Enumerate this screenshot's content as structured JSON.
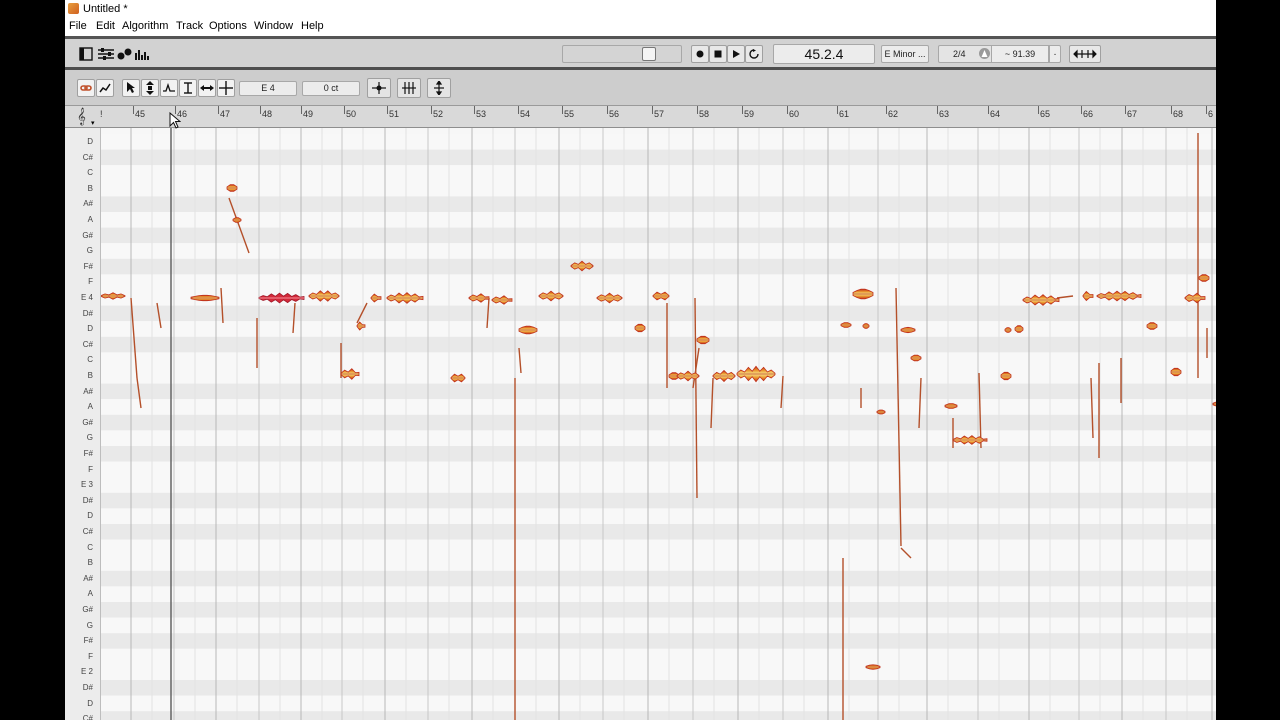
{
  "window": {
    "title": "Untitled *"
  },
  "menu": [
    "File",
    "Edit",
    "Algorithm",
    "Track",
    "Options",
    "Window",
    "Help"
  ],
  "main_toolbar": {
    "position": "45.2.4",
    "key": "E Minor ...",
    "time_signature": "2/4",
    "tempo": "~ 91.39",
    "tempo_dropdown": "."
  },
  "edit_toolbar": {
    "note_field": "E 4",
    "cents_field": "0 ct"
  },
  "ruler": {
    "bars": [
      "45",
      "46",
      "47",
      "48",
      "49",
      "50",
      "51",
      "52",
      "53",
      "54",
      "55",
      "56",
      "57",
      "58",
      "59",
      "60",
      "61",
      "62",
      "63",
      "64",
      "65",
      "66",
      "67",
      "68",
      "6"
    ]
  },
  "pitch_labels": [
    "D",
    "C#",
    "C",
    "B",
    "A#",
    "A",
    "G#",
    "G",
    "F#",
    "F",
    "E 4",
    "D#",
    "D",
    "C#",
    "C",
    "B",
    "A#",
    "A",
    "G#",
    "G",
    "F#",
    "F",
    "E 3",
    "D#",
    "D",
    "C#",
    "C",
    "B",
    "A#",
    "A",
    "G#",
    "G",
    "F#",
    "F",
    "E 2",
    "D#",
    "D",
    "C#"
  ],
  "colors": {
    "blob_outer": "#d98a1c",
    "blob_inner": "#f7df7a",
    "blob_edge": "#c0301c",
    "selected_blob": "#d42a3a",
    "pitch_line": "#b4502a",
    "black_key_row": "#e9e9e9",
    "white_key_row": "#f8f8f8"
  },
  "icons": {
    "layout": "layout-icon",
    "mixer": "mixer-icon",
    "record": "record-icon",
    "stop": "stop-icon",
    "play": "play-icon",
    "loop": "loop-icon"
  }
}
